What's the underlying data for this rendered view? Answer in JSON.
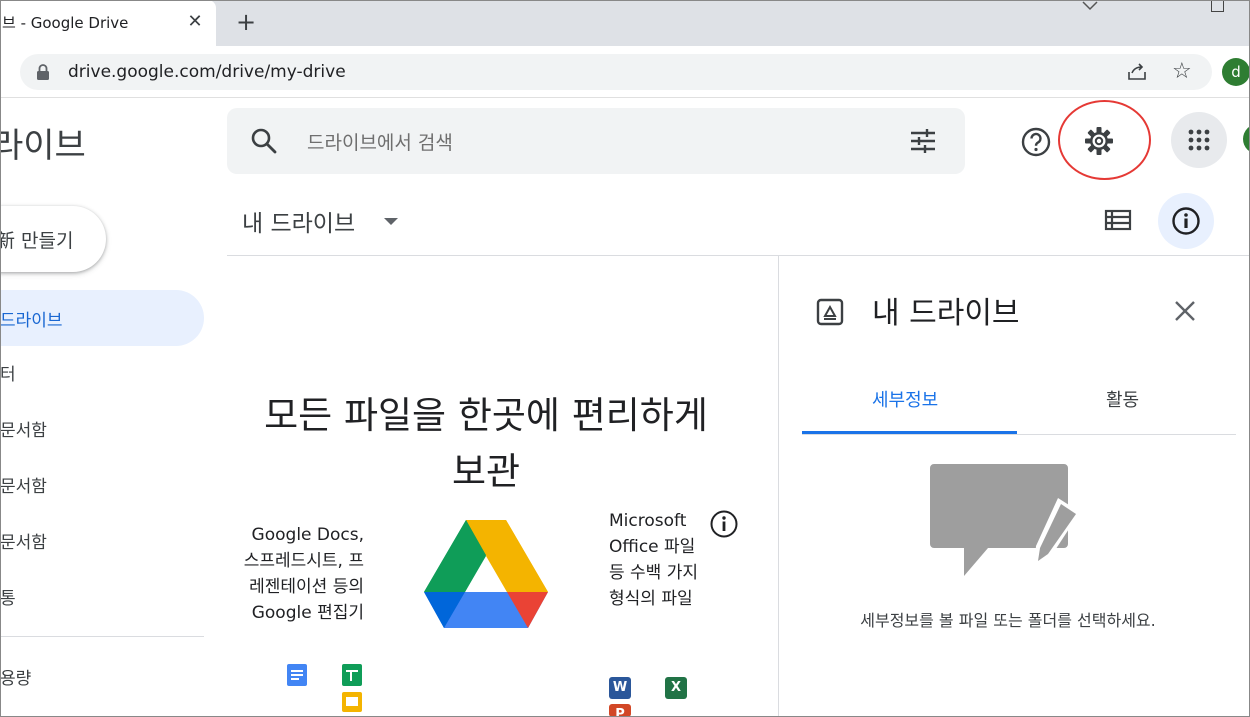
{
  "browser": {
    "tab_title": "브 - Google Drive",
    "tab_close": "✕",
    "new_tab": "+",
    "url": "drive.google.com/drive/my-drive",
    "profile_initial": "d"
  },
  "header": {
    "app_title": "라이브",
    "search_placeholder": "드라이브에서 검색"
  },
  "sidebar": {
    "new_button_label": "新 만들기",
    "items": [
      {
        "label": "드라이브",
        "active": true
      },
      {
        "label": "터"
      },
      {
        "label": "문서함"
      },
      {
        "label": "문서함"
      },
      {
        "label": "문서함"
      },
      {
        "label": "통"
      },
      {
        "label": "용량"
      }
    ]
  },
  "main": {
    "breadcrumb": "내 드라이브",
    "headline_line1": "모든 파일을 한곳에 편리하게",
    "headline_line2": "보관",
    "promo_left": "Google Docs, 스프레드시트, 프레젠테이션 등의 Google 편집기",
    "promo_right": "Microsoft Office 파일 등 수백 가지 형식의 파일",
    "office_icons": [
      "W",
      "X",
      "P"
    ]
  },
  "details_panel": {
    "title": "내 드라이브",
    "tabs": [
      "세부정보",
      "활동"
    ],
    "active_tab": "세부정보",
    "empty_message": "세부정보를 볼 파일 또는 폴더를 선택하세요."
  },
  "colors": {
    "accent_blue": "#1a73e8",
    "highlight_red": "#e53935",
    "active_nav_bg": "#e8f0fe"
  }
}
